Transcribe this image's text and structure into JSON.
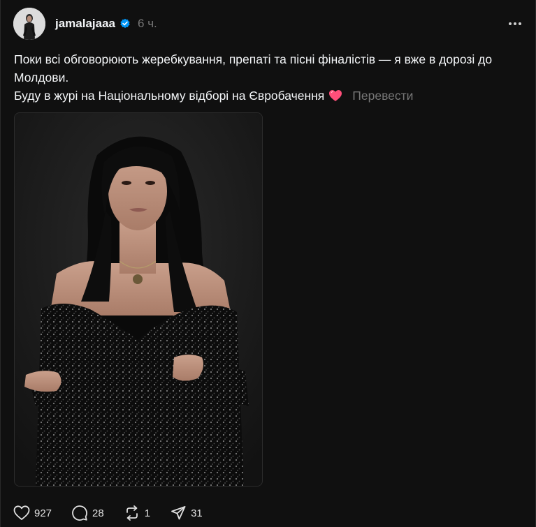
{
  "post": {
    "username": "jamalajaaa",
    "verified": true,
    "time": "6 ч.",
    "text_lines": [
      "Поки всі обговорюють жеребкування, препаті та пісні фіналістів — я вже в дорозі до Молдови.",
      "Буду в журі на Національному відборі на Євробачення"
    ],
    "emoji": "heart-emoji",
    "translate_label": "Перевести"
  },
  "actions": {
    "likes": "927",
    "comments": "28",
    "reposts": "1",
    "shares": "31"
  },
  "icons": {
    "verified": "verified-badge-icon",
    "more": "more-options-icon",
    "like": "heart-icon",
    "comment": "comment-icon",
    "repost": "repost-icon",
    "share": "share-icon"
  },
  "colors": {
    "background": "#101010",
    "text": "#f3f5f7",
    "muted": "#777777",
    "verified_blue": "#0095f6",
    "emoji_pink": "#ff4f7a"
  }
}
